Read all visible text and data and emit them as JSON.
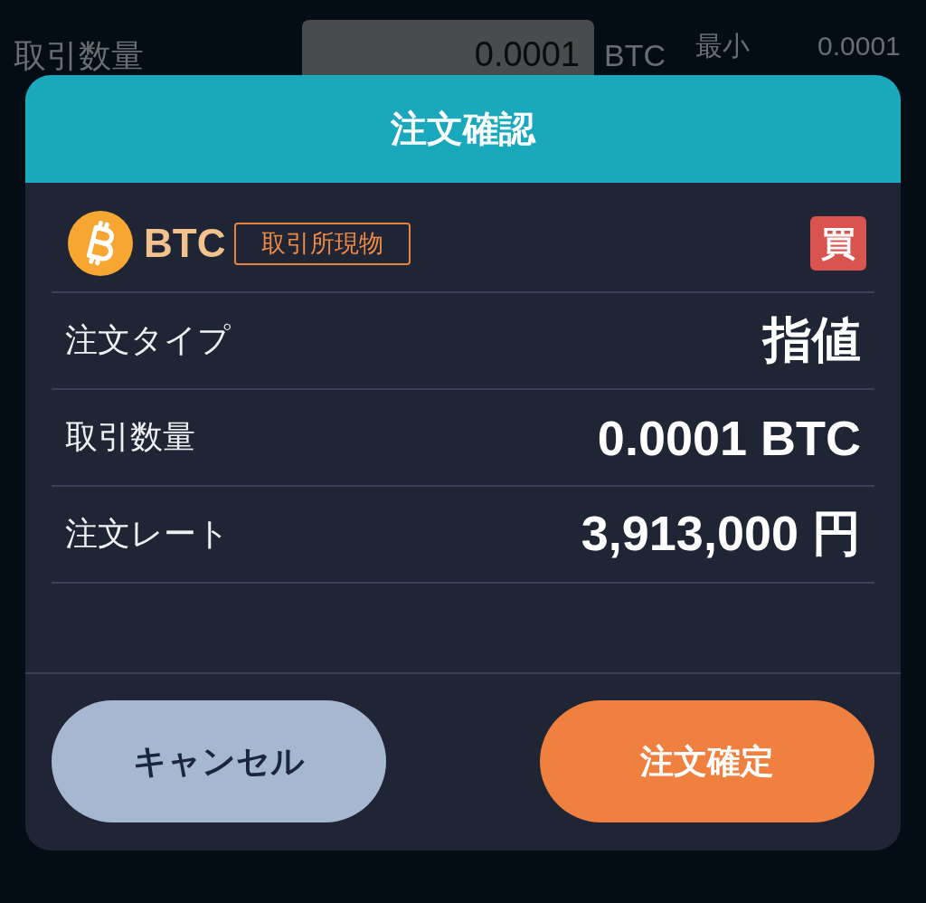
{
  "background_form": {
    "quantity_label": "取引数量",
    "quantity_input": {
      "value": "0.0001"
    },
    "quantity_unit": "BTC",
    "min_label": "最小",
    "min_value": "0.0001"
  },
  "dialog": {
    "title": "注文確認",
    "asset": {
      "symbol": "BTC",
      "market_tag": "取引所現物",
      "side_badge": "買"
    },
    "rows": [
      {
        "label": "注文タイプ",
        "value": "指値"
      },
      {
        "label": "取引数量",
        "value": "0.0001 BTC"
      },
      {
        "label": "注文レート",
        "value": "3,913,000 円"
      }
    ],
    "buttons": [
      {
        "kind": "cancel",
        "label": "キャンセル"
      },
      {
        "kind": "confirm",
        "label": "注文確定"
      }
    ]
  }
}
